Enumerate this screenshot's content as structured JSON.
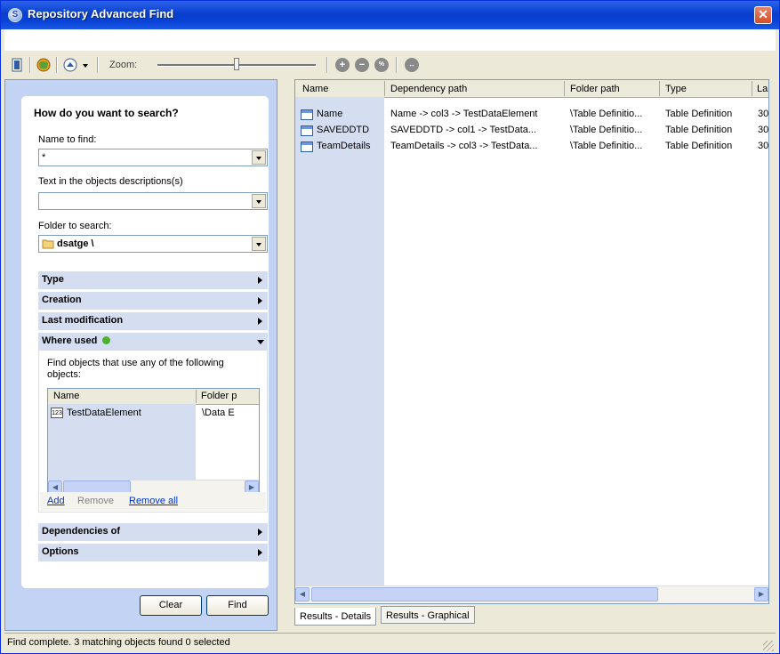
{
  "window": {
    "title": "Repository Advanced Find",
    "close_glyph": "✕"
  },
  "toolbar": {
    "zoom_label": "Zoom:",
    "zoom_level": 0.5
  },
  "search": {
    "heading": "How do you want to search?",
    "name_label": "Name to find:",
    "name_value": "*",
    "desc_label": "Text in the objects descriptions(s)",
    "desc_value": "",
    "folder_label": "Folder to search:",
    "folder_value": "dsatge \\",
    "sections": {
      "type": "Type",
      "creation": "Creation",
      "last_modification": "Last modification",
      "where_used": "Where used",
      "dependencies": "Dependencies of",
      "options": "Options"
    },
    "where_used": {
      "description": "Find objects that use any of the following objects:",
      "columns": [
        "Name",
        "Folder p"
      ],
      "rows": [
        {
          "name": "TestDataElement",
          "folder": "\\Data E"
        }
      ],
      "add": "Add",
      "remove": "Remove",
      "remove_all": "Remove all"
    },
    "clear_button": "Clear",
    "find_button": "Find"
  },
  "results": {
    "columns": [
      "Name",
      "Dependency path",
      "Folder path",
      "Type",
      "La"
    ],
    "rows": [
      {
        "name": "Name",
        "dep": "Name -> col3 -> TestDataElement",
        "folder": "\\Table Definitio...",
        "type": "Table Definition",
        "la": "30"
      },
      {
        "name": "SAVEDDTD",
        "dep": "SAVEDDTD -> col1 -> TestData...",
        "folder": "\\Table Definitio...",
        "type": "Table Definition",
        "la": "30"
      },
      {
        "name": "TeamDetails",
        "dep": "TeamDetails -> col3 -> TestData...",
        "folder": "\\Table Definitio...",
        "type": "Table Definition",
        "la": "30"
      }
    ],
    "tabs": [
      "Results - Details",
      "Results - Graphical"
    ]
  },
  "status": {
    "text": "Find complete.  3 matching objects found  0 selected"
  },
  "icons": {
    "accent": "#0a3ecf",
    "green": "#4bb32a"
  }
}
